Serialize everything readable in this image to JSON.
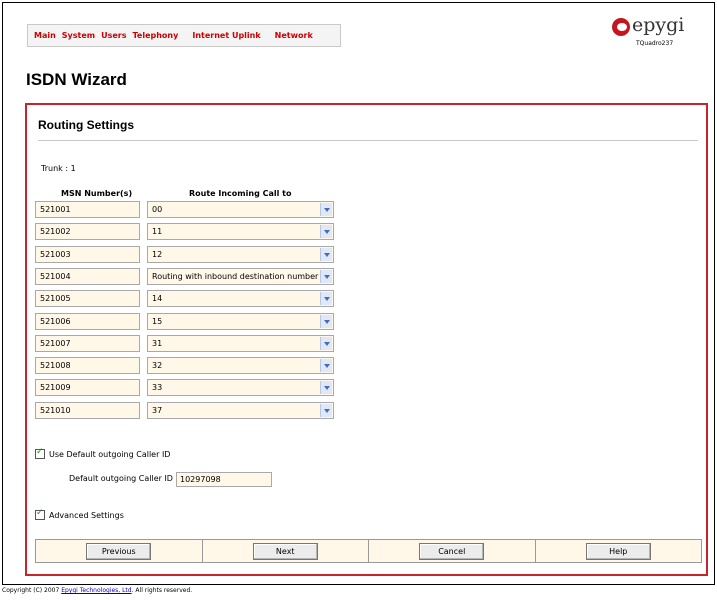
{
  "nav": {
    "items": [
      "Main",
      "System",
      "Users",
      "Telephony",
      "Internet Uplink",
      "Network"
    ]
  },
  "logo": {
    "brand": "epygi",
    "model": "TQuadro237"
  },
  "page_title": "ISDN Wizard",
  "section_title": "Routing Settings",
  "trunk": {
    "label": "Trunk :",
    "value": "1"
  },
  "columns": {
    "msn": "MSN Number(s)",
    "route": "Route Incoming Call to"
  },
  "rows": [
    {
      "msn": "521001",
      "route": "00"
    },
    {
      "msn": "521002",
      "route": "11"
    },
    {
      "msn": "521003",
      "route": "12"
    },
    {
      "msn": "521004",
      "route": "Routing with inbound destination number"
    },
    {
      "msn": "521005",
      "route": "14"
    },
    {
      "msn": "521006",
      "route": "15"
    },
    {
      "msn": "521007",
      "route": "31"
    },
    {
      "msn": "521008",
      "route": "32"
    },
    {
      "msn": "521009",
      "route": "33"
    },
    {
      "msn": "521010",
      "route": "37"
    }
  ],
  "use_default_caller_id": {
    "label": "Use Default outgoing Caller ID",
    "checked": true
  },
  "default_caller_id": {
    "label": "Default outgoing Caller ID",
    "value": "10297098"
  },
  "advanced_settings": {
    "label": "Advanced Settings",
    "checked": true
  },
  "buttons": {
    "previous": "Previous",
    "next": "Next",
    "cancel": "Cancel",
    "help": "Help"
  },
  "footer": {
    "prefix": "Copyright (C) 2007",
    "company": "Epygi Technologies, Ltd",
    "suffix": ". All rights reserved."
  },
  "colors": {
    "accent": "#cc0000",
    "field_bg": "#fff7e8",
    "panel_border": "#c9242b"
  }
}
